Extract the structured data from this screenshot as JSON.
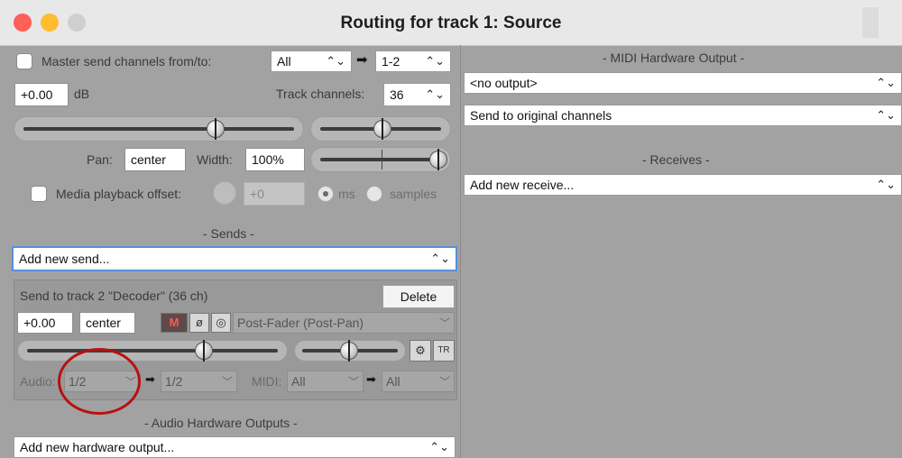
{
  "window": {
    "title": "Routing for track 1: Source"
  },
  "master": {
    "checkbox_label": "Master send channels from/to:",
    "from_value": "All",
    "to_value": "1-2"
  },
  "volume": {
    "value": "+0.00",
    "unit": "dB"
  },
  "track_channels": {
    "label": "Track channels:",
    "value": "36"
  },
  "pan": {
    "label": "Pan:",
    "value": "center",
    "width_label": "Width:",
    "width_value": "100%"
  },
  "media_offset": {
    "label": "Media playback offset:",
    "value": "+0",
    "ms_label": "ms",
    "samples_label": "samples"
  },
  "sends": {
    "section_title": "- Sends -",
    "add_new": "Add new send...",
    "send": {
      "title": "Send to track 2 \"Decoder\" (36 ch)",
      "delete_label": "Delete",
      "volume": "+0.00",
      "pan": "center",
      "mute_icon": "M",
      "mode": "Post-Fader (Post-Pan)",
      "audio_label": "Audio:",
      "audio_from": "1/2",
      "audio_to": "1/2",
      "midi_label": "MIDI:",
      "midi_from": "All",
      "midi_to": "All",
      "env_tr_label": "TR"
    }
  },
  "audio_hw": {
    "section_title": "- Audio Hardware Outputs -",
    "add_new": "Add new hardware output..."
  },
  "midi_hw": {
    "section_title": "- MIDI Hardware Output -",
    "output": "<no output>",
    "channels": "Send to original channels"
  },
  "receives": {
    "section_title": "- Receives -",
    "add_new": "Add new receive..."
  },
  "colors": {
    "panel_bg": "#a2a2a2",
    "titlebar_bg": "#e8e8e8",
    "annotation_red": "#b81111",
    "focus_blue": "#5b8fd6"
  }
}
